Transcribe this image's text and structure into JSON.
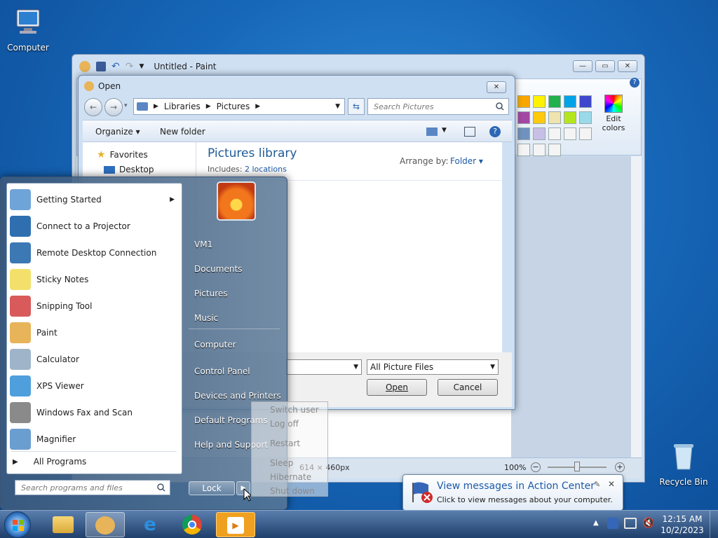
{
  "desktop": {
    "computer_label": "Computer",
    "recycle_label": "Recycle Bin"
  },
  "paint": {
    "title": "Untitled - Paint",
    "edit_colors": "Edit colors",
    "size": "614 × 460px",
    "zoom": "100%",
    "palette": [
      "#f7a700",
      "#fff200",
      "#22b14c",
      "#00a2e8",
      "#3f48cc",
      "#a349a4",
      "#ffc90e",
      "#efe4b0",
      "#b5e61d",
      "#99d9ea",
      "#7092be",
      "#c8bfe7"
    ]
  },
  "open": {
    "title": "Open",
    "addr": [
      "Libraries",
      "Pictures"
    ],
    "search_placeholder": "Search Pictures",
    "organize": "Organize",
    "new_folder": "New folder",
    "favorites": "Favorites",
    "desktop": "Desktop",
    "lib_title": "Pictures library",
    "includes": "Includes:",
    "locations": "2 locations",
    "arrange_by": "Arrange by:",
    "arrange_val": "Folder",
    "filetype": "All Picture Files",
    "open_btn": "Open",
    "cancel_btn": "Cancel"
  },
  "start": {
    "programs": [
      {
        "label": "Getting Started",
        "icon": "getting-started-icon",
        "color": "#6fa4d8",
        "arrow": true
      },
      {
        "label": "Connect to a Projector",
        "icon": "projector-icon",
        "color": "#2f6fb0"
      },
      {
        "label": "Remote Desktop Connection",
        "icon": "remote-desktop-icon",
        "color": "#3c78b4"
      },
      {
        "label": "Sticky Notes",
        "icon": "sticky-notes-icon",
        "color": "#f2e06b"
      },
      {
        "label": "Snipping Tool",
        "icon": "scissors-icon",
        "color": "#d85a5a"
      },
      {
        "label": "Paint",
        "icon": "paint-palette-icon",
        "color": "#e8b45a"
      },
      {
        "label": "Calculator",
        "icon": "calculator-icon",
        "color": "#9fb4c9"
      },
      {
        "label": "XPS Viewer",
        "icon": "xps-viewer-icon",
        "color": "#4f9fdc"
      },
      {
        "label": "Windows Fax and Scan",
        "icon": "fax-icon",
        "color": "#8a8a8a"
      },
      {
        "label": "Magnifier",
        "icon": "magnifier-icon",
        "color": "#6a9ed0"
      }
    ],
    "all_programs": "All Programs",
    "search_placeholder": "Search programs and files",
    "right": [
      "VM1",
      "Documents",
      "Pictures",
      "Music",
      "Computer",
      "Control Panel",
      "Devices and Printers",
      "Default Programs",
      "Help and Support"
    ],
    "lock": "Lock",
    "power": [
      "Switch user",
      "Log off",
      "Restart",
      "Sleep",
      "Hibernate",
      "Shut down"
    ]
  },
  "notification": {
    "title": "View messages in Action Center",
    "body": "Click to view messages about your computer."
  },
  "clock": {
    "time": "12:15 AM",
    "date": "10/2/2023"
  }
}
